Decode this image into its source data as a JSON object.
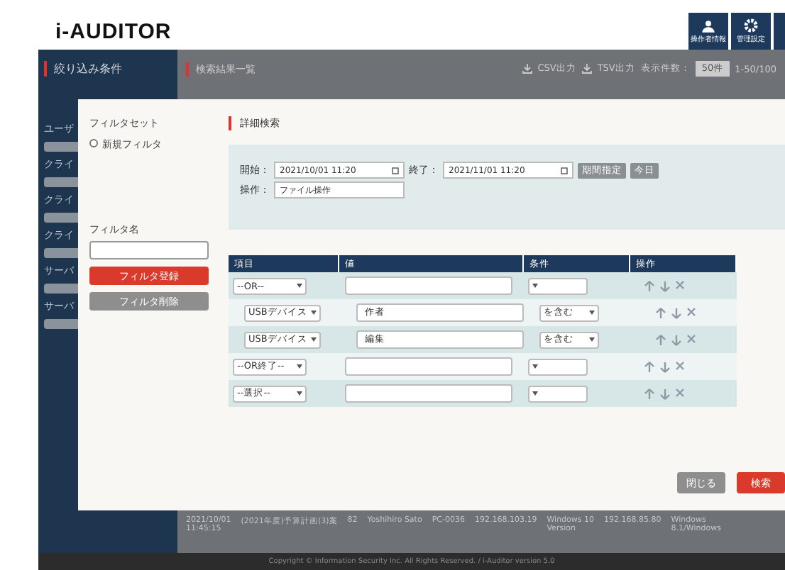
{
  "header": {
    "logo": "i-AUDITOR",
    "icons": [
      {
        "kind": "people",
        "label": "操作者情報"
      },
      {
        "kind": "gear",
        "label": "管理設定"
      }
    ]
  },
  "sidebar": {
    "title": "絞り込み条件",
    "labels": [
      "ユーザ",
      "クライ",
      "クライ",
      "クライ",
      "サーバ",
      "サーバ"
    ]
  },
  "main": {
    "title": "検索結果一覧",
    "actions": [
      "CSV出力",
      "TSV出力"
    ],
    "page_size_label": "表示件数：",
    "page_size": "50件",
    "range": "1-50/100",
    "row": [
      [
        "2021/10/01",
        "11:45:15"
      ],
      [
        "(2021年度)予算計画(3)案"
      ],
      [
        "82"
      ],
      [
        "Yoshihiro Sato"
      ],
      [
        "PC-0036"
      ],
      [
        "192.168.103.19"
      ],
      [
        "Windows 10",
        "Version"
      ],
      [
        "192.168.85.80"
      ],
      [
        "Windows",
        "8.1/Windows"
      ]
    ]
  },
  "modal": {
    "filter_set_label": "フィルタセット",
    "filters": [
      {
        "label": "新規フィルタ",
        "selected": false
      }
    ],
    "filter_name_label": "フィルタ名",
    "register_button": "フィルタ登録",
    "delete_button": "フィルタ削除",
    "title": "詳細検索",
    "start_label": "開始：",
    "start": "2021/10/01 11:20",
    "end_label": "終了：",
    "end": "2021/11/01 11:20",
    "date_buttons": [
      "期間指定",
      "今日"
    ],
    "operation_label": "操作：",
    "operation": "ファイル操作",
    "columns": [
      "項目",
      "値",
      "条件",
      "操作"
    ],
    "rows": [
      {
        "nested": false,
        "item": "--OR--"
      },
      {
        "nested": true,
        "item": "USBデバイス",
        "value": "作者",
        "condition": "を含む"
      },
      {
        "nested": true,
        "item": "USBデバイス",
        "value": "編集",
        "condition": "を含む"
      },
      {
        "nested": false,
        "item": "--OR終了--"
      },
      {
        "nested": false,
        "item": "--選択--"
      }
    ],
    "close_button": "閉じる",
    "search_button": "検索"
  },
  "footer": "Copyright © Information Security Inc. All Rights Reserved. / i-Auditor version 5.0"
}
